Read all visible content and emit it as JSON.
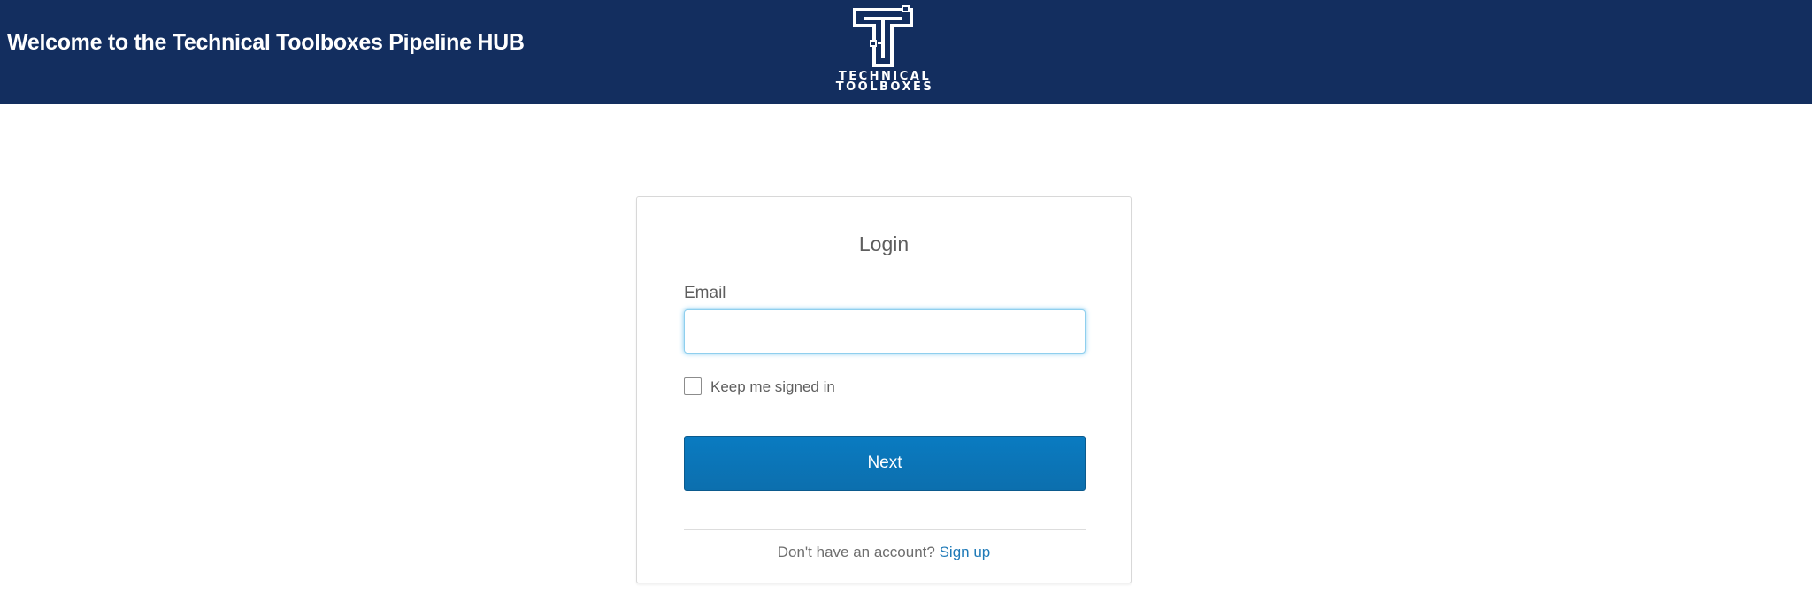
{
  "header": {
    "title": "Welcome to the Technical Toolboxes Pipeline HUB",
    "background_color": "#132e5f",
    "logo": {
      "icon": "technical-toolboxes-tt-logo",
      "line1": "TECHNICAL",
      "line2": "TOOLBOXES"
    }
  },
  "login": {
    "title": "Login",
    "email_label": "Email",
    "email_value": "",
    "email_placeholder": "",
    "keep_signed_in_label": "Keep me signed in",
    "keep_signed_in_checked": false,
    "next_label": "Next",
    "next_color": "#0a74b8",
    "no_account_text": "Don't have an account?",
    "signup_label": "Sign up",
    "link_color": "#1f7ab8"
  }
}
